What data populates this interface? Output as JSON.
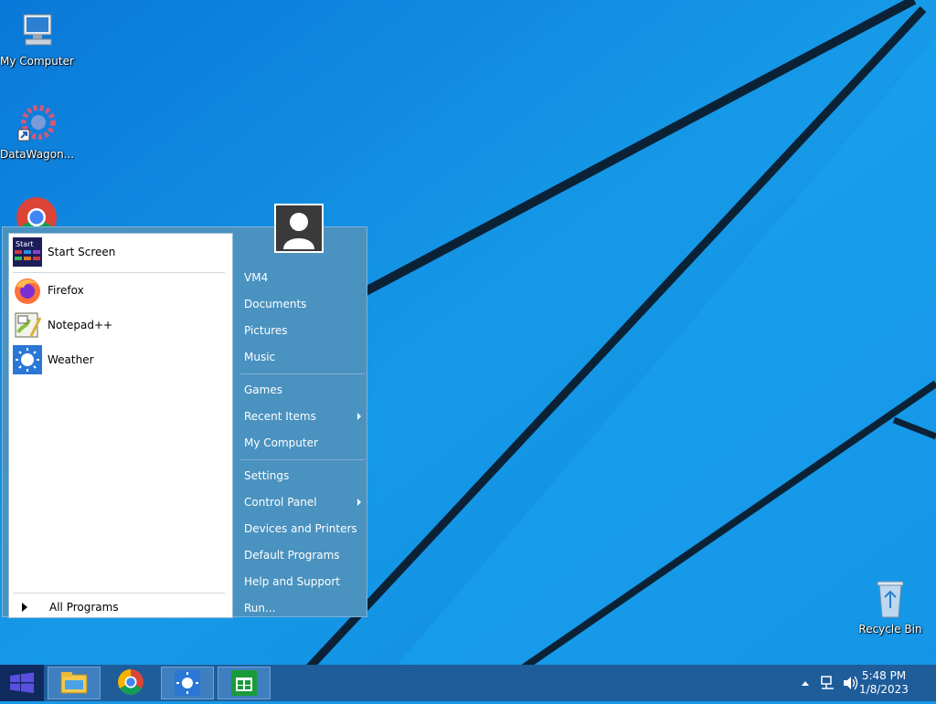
{
  "desktop": {
    "icons": [
      {
        "label": "My Computer"
      },
      {
        "label": "DataWagon..."
      },
      {
        "label": "Recycle Bin"
      }
    ]
  },
  "start_menu": {
    "programs": [
      {
        "label": "Start Screen",
        "icon": "start-screen-icon"
      },
      {
        "label": "Firefox",
        "icon": "firefox-icon"
      },
      {
        "label": "Notepad++",
        "icon": "notepad-plus-plus-icon"
      },
      {
        "label": "Weather",
        "icon": "weather-icon"
      }
    ],
    "start_screen_icon_text": "Start",
    "all_programs": "All Programs",
    "right": {
      "user": "VM4",
      "documents": "Documents",
      "pictures": "Pictures",
      "music": "Music",
      "games": "Games",
      "recent_items": "Recent Items",
      "my_computer": "My Computer",
      "settings": "Settings",
      "control_panel": "Control Panel",
      "devices_printers": "Devices and Printers",
      "default_programs": "Default Programs",
      "help_support": "Help and Support",
      "run": "Run..."
    }
  },
  "taskbar": {
    "time": "5:48 PM",
    "date": "1/8/2023"
  },
  "colors": {
    "wallpaper": "#1798e6",
    "taskbar": "#1e5c9a",
    "start_menu": "#4a92c0"
  }
}
